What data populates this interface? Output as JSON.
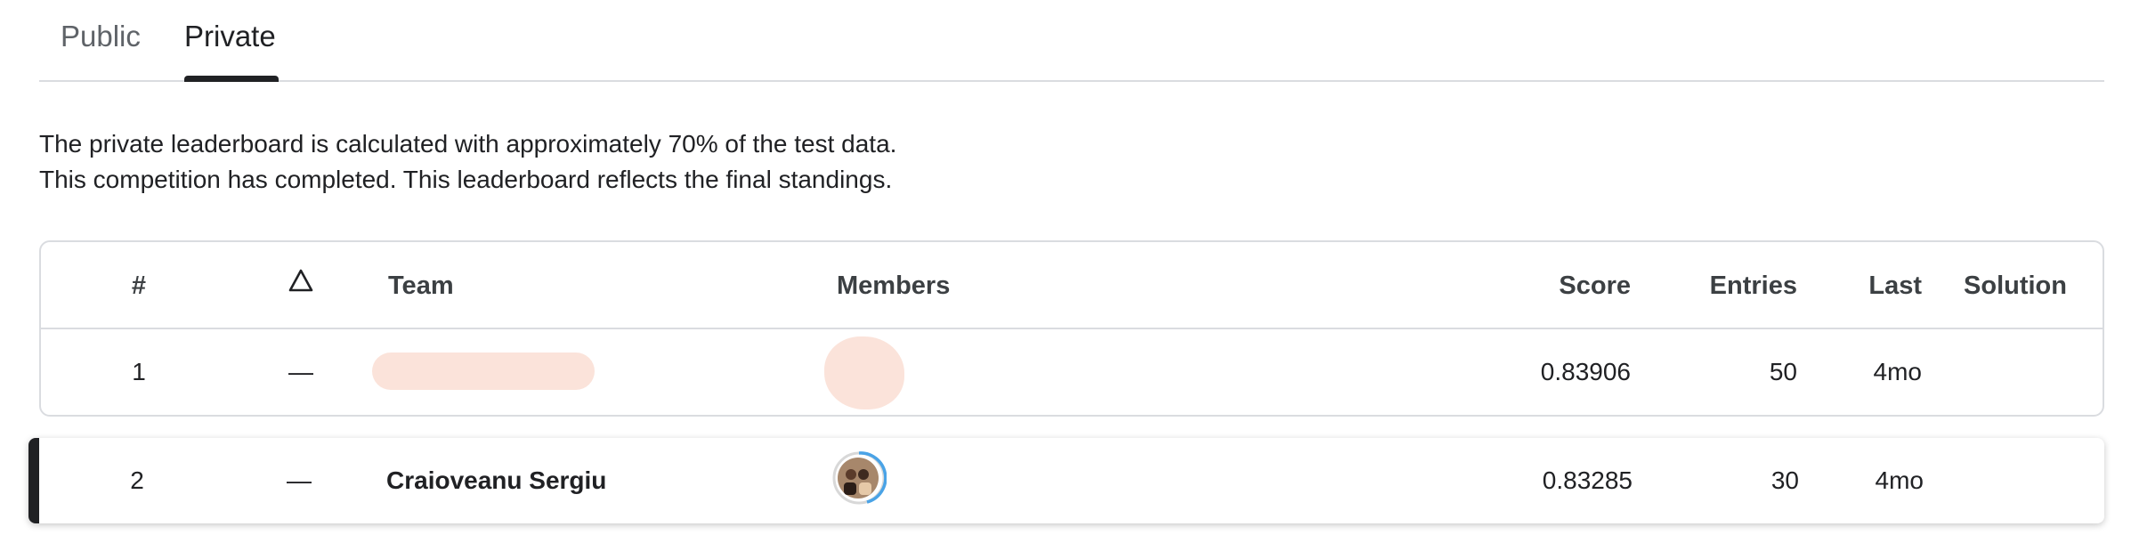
{
  "tabs": {
    "public_label": "Public",
    "private_label": "Private"
  },
  "description": {
    "line1": "The private leaderboard is calculated with approximately 70% of the test data.",
    "line2": "This competition has completed. This leaderboard reflects the final standings."
  },
  "table": {
    "headers": {
      "rank": "#",
      "delta_icon": "triangle-outline-icon",
      "team": "Team",
      "members": "Members",
      "score": "Score",
      "entries": "Entries",
      "last": "Last",
      "solution": "Solution"
    },
    "rows": [
      {
        "rank": "1",
        "delta": "—",
        "score": "0.83906",
        "entries": "50",
        "last": "4mo"
      },
      {
        "rank": "2",
        "delta": "—",
        "team": "Craioveanu Sergiu",
        "score": "0.83285",
        "entries": "30",
        "last": "4mo"
      }
    ]
  },
  "colors": {
    "accent_dark": "#202124",
    "border": "#dadce0",
    "redacted": "#fbe3da",
    "avatar_ring": "#4aa3e6"
  }
}
